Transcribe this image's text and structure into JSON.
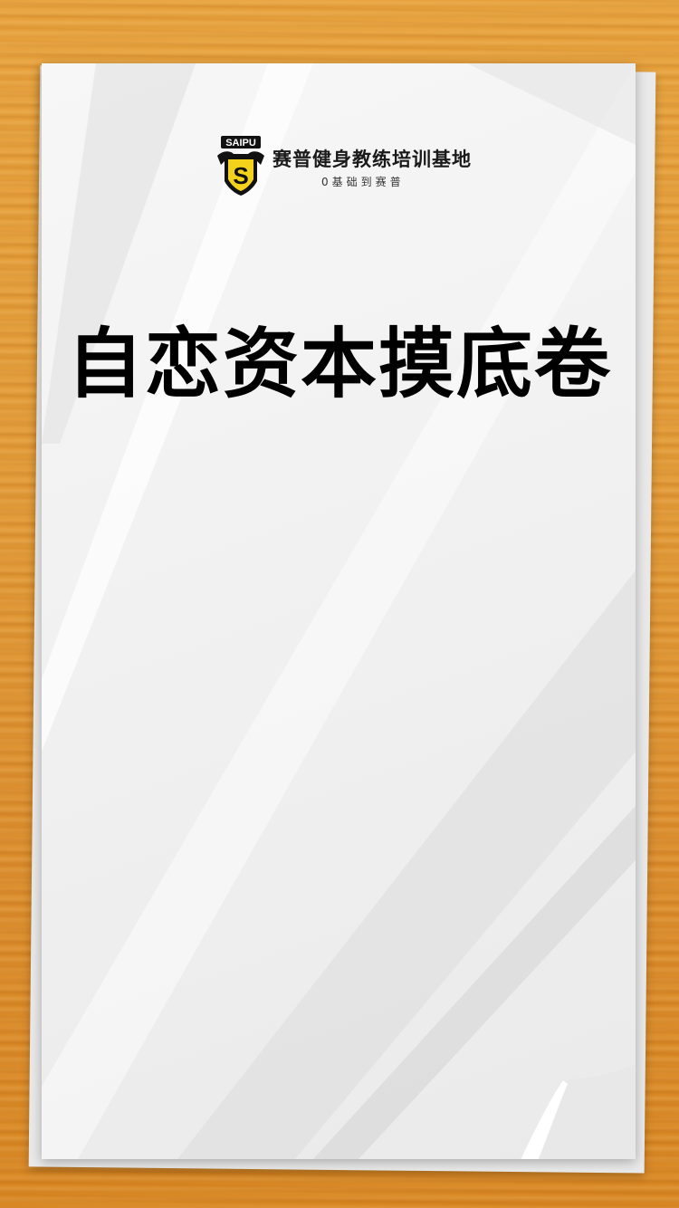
{
  "logo": {
    "badge_text": "SAIPU",
    "emblem_letter": "S"
  },
  "brand": {
    "name": "赛普健身教练培训基地",
    "tagline": "0基础到赛普"
  },
  "title": "自恋资本摸底卷",
  "colors": {
    "wood": "#e29a36",
    "paper": "#f3f3f3",
    "emblem_yellow": "#f2d21a",
    "text": "#000000"
  }
}
